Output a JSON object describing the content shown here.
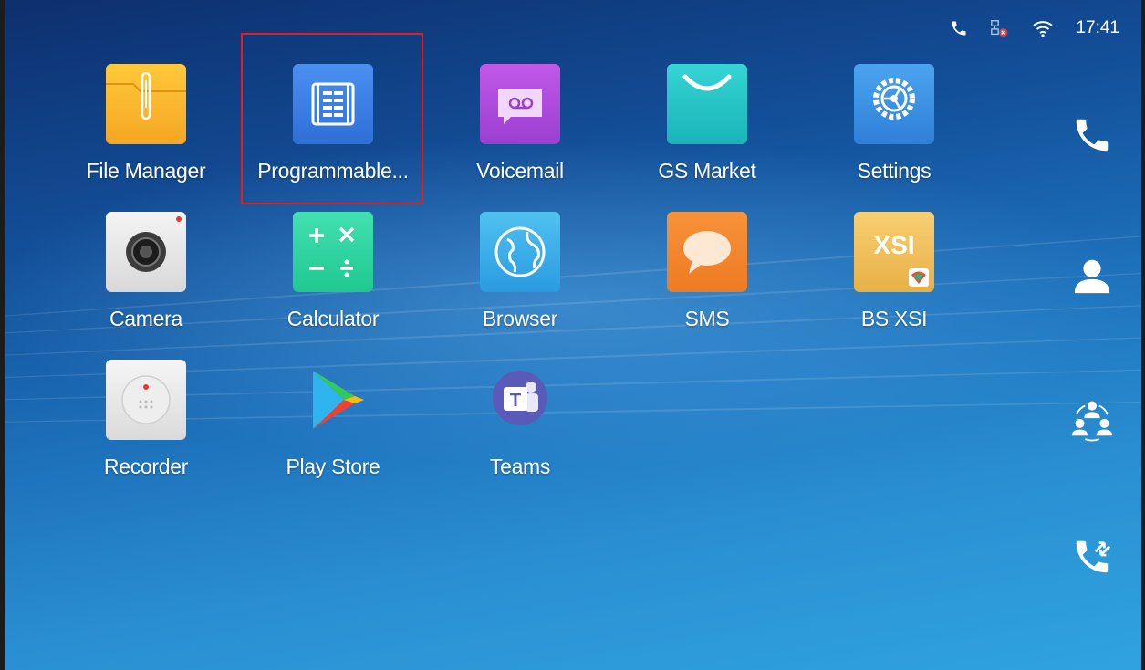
{
  "status_bar": {
    "time": "17:41",
    "icons": [
      "phone-icon",
      "network-icon",
      "wifi-icon"
    ]
  },
  "apps": [
    {
      "label": "File Manager",
      "icon": "file-manager-icon"
    },
    {
      "label": "Programmable...",
      "icon": "programmable-keys-icon"
    },
    {
      "label": "Voicemail",
      "icon": "voicemail-icon"
    },
    {
      "label": "GS Market",
      "icon": "gs-market-icon"
    },
    {
      "label": "Settings",
      "icon": "settings-icon"
    },
    {
      "label": "Camera",
      "icon": "camera-icon"
    },
    {
      "label": "Calculator",
      "icon": "calculator-icon"
    },
    {
      "label": "Browser",
      "icon": "browser-icon"
    },
    {
      "label": "SMS",
      "icon": "sms-icon"
    },
    {
      "label": "BS XSI",
      "icon": "bs-xsi-icon",
      "icon_text": "XSI"
    },
    {
      "label": "Recorder",
      "icon": "recorder-icon"
    },
    {
      "label": "Play Store",
      "icon": "play-store-icon"
    },
    {
      "label": "Teams",
      "icon": "teams-icon",
      "icon_text": "T"
    }
  ],
  "dock": [
    "phone-icon",
    "contacts-icon",
    "conference-icon",
    "call-transfer-icon"
  ],
  "colors": {
    "highlight": "#e02020",
    "background_top": "#0d2f6e",
    "background_bottom": "#2fa3e0"
  }
}
